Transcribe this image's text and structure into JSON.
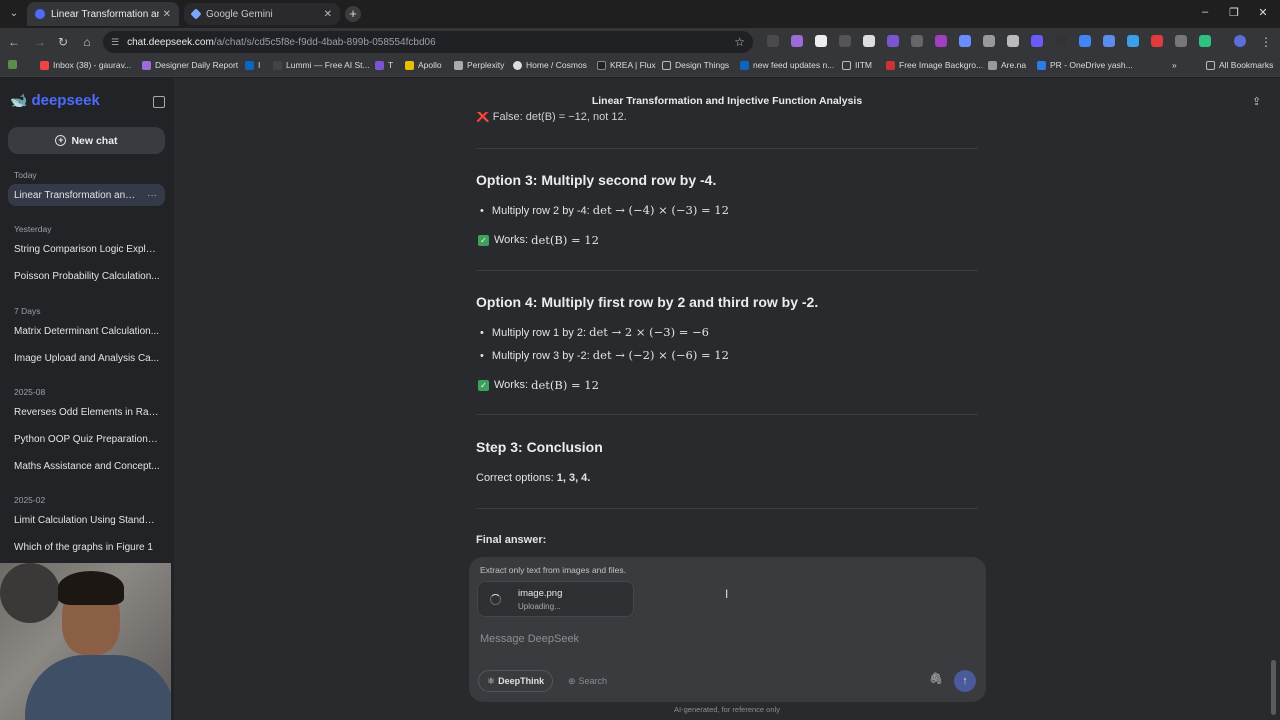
{
  "browser": {
    "tabs": [
      {
        "label": "Linear Transformation and Injec",
        "active": true
      },
      {
        "label": "Google Gemini",
        "active": false
      }
    ],
    "address": {
      "site": "chat.deepseek.com",
      "path": "/a/chat/s/cd5c5f8e-f9dd-4bab-899b-058554fcbd06"
    },
    "bookmarks": [
      "Inbox (38) - gaurav...",
      "Designer Daily Report",
      "I",
      "Lummi — Free AI St...",
      "T",
      "Apollo",
      "Perplexity",
      "Home / Cosmos",
      "KREA | Flux",
      "Design Things",
      "new feed updates n...",
      "IITM",
      "Free Image Backgro...",
      "Are.na",
      "PR - OneDrive yash...",
      "All Bookmarks"
    ]
  },
  "sidebar": {
    "logo": "deepseek",
    "new_chat": "New chat",
    "groups": [
      {
        "label": "Today",
        "items": [
          "Linear Transformation and In"
        ]
      },
      {
        "label": "Yesterday",
        "items": [
          "String Comparison Logic Explai...",
          "Poisson Probability Calculation..."
        ]
      },
      {
        "label": "7 Days",
        "items": [
          "Matrix Determinant Calculation...",
          "Image Upload and Analysis Ca..."
        ]
      },
      {
        "label": "2025-08",
        "items": [
          "Reverses Odd Elements in Range",
          "Python OOP Quiz Preparation E...",
          "Maths Assistance and Concept..."
        ]
      },
      {
        "label": "2025-02",
        "items": [
          "Limit Calculation Using Standar...",
          "Which of the graphs in Figure 1"
        ]
      }
    ]
  },
  "chat": {
    "title": "Linear Transformation and Injective Function Analysis",
    "fragment": "❌ False: det(B) = −12, not 12.",
    "option3": {
      "heading": "Option 3: Multiply second row by -4.",
      "bullet_label": "Multiply row 2 by -4:",
      "bullet_math": "det → (−4) × (−3) = 12",
      "works_label": "Works:",
      "works_math": "det(B) = 12"
    },
    "option4": {
      "heading": "Option 4: Multiply first row by 2 and third row by -2.",
      "bullet1_label": "Multiply row 1 by 2:",
      "bullet1_math": "det → 2 × (−3) = −6",
      "bullet2_label": "Multiply row 3 by -2:",
      "bullet2_math": "det → (−2) × (−6) = 12",
      "works_label": "Works:",
      "works_math": "det(B) = 12"
    },
    "step3": {
      "heading": "Step 3: Conclusion",
      "text_label": "Correct options:",
      "text_value": "1, 3, 4."
    },
    "final_answer": "Final answer:"
  },
  "composer": {
    "hint": "Extract only text from images and files.",
    "file_name": "image.png",
    "file_status": "Uploading...",
    "placeholder": "Message DeepSeek",
    "deepthink": "DeepThink",
    "search": "Search",
    "disclaimer": "AI-generated, for reference only"
  },
  "colors": {
    "accent": "#4d6bfe",
    "check": "#3da15d",
    "background": "#292a2d",
    "sidebar": "#212327"
  }
}
